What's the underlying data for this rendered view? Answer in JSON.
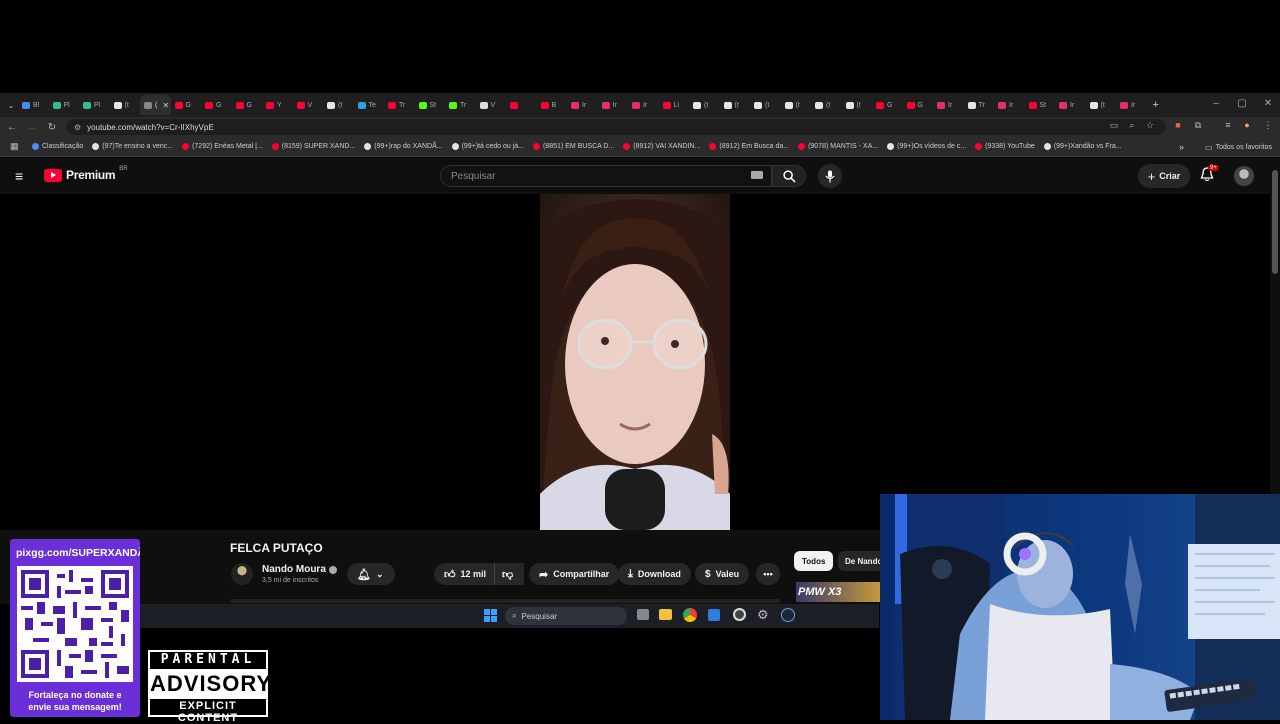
{
  "browser": {
    "tabs": [
      {
        "label": "Bl",
        "color": "#4c8bf5"
      },
      {
        "label": "Pl",
        "color": "#3fb68b"
      },
      {
        "label": "Pl",
        "color": "#3fb68b"
      },
      {
        "label": "(t",
        "color": "#e6e6e6"
      },
      {
        "label": "(",
        "color": "#888888",
        "active": true
      },
      {
        "label": "G",
        "color": "#ff0033"
      },
      {
        "label": "G",
        "color": "#ff0033"
      },
      {
        "label": "G",
        "color": "#ff0033"
      },
      {
        "label": "Y",
        "color": "#ff0033"
      },
      {
        "label": "V",
        "color": "#ff0033"
      },
      {
        "label": "(t",
        "color": "#e6e6e6"
      },
      {
        "label": "Te",
        "color": "#2aa3df"
      },
      {
        "label": "Tr",
        "color": "#ff0033"
      },
      {
        "label": "St",
        "color": "#53fc18"
      },
      {
        "label": "Tr",
        "color": "#53fc18"
      },
      {
        "label": "V",
        "color": "#dddddd"
      },
      {
        "label": "",
        "color": "#ff0033"
      },
      {
        "label": "B",
        "color": "#ff0033"
      },
      {
        "label": "Ir",
        "color": "#e1306c"
      },
      {
        "label": "Ir",
        "color": "#e1306c"
      },
      {
        "label": "Ir",
        "color": "#e1306c"
      },
      {
        "label": "Li",
        "color": "#ff0033"
      },
      {
        "label": "(t",
        "color": "#e6e6e6"
      },
      {
        "label": "(t",
        "color": "#e6e6e6"
      },
      {
        "label": "(t",
        "color": "#e6e6e6"
      },
      {
        "label": "(t",
        "color": "#e6e6e6"
      },
      {
        "label": "(t",
        "color": "#e6e6e6"
      },
      {
        "label": "(t",
        "color": "#e6e6e6"
      },
      {
        "label": "G",
        "color": "#ff0033"
      },
      {
        "label": "G",
        "color": "#ff0033"
      },
      {
        "label": "Ir",
        "color": "#e1306c"
      },
      {
        "label": "Tr",
        "color": "#e6e6e6"
      },
      {
        "label": "Ir",
        "color": "#e1306c"
      },
      {
        "label": "St",
        "color": "#ff0033"
      },
      {
        "label": "Ir",
        "color": "#e1306c"
      },
      {
        "label": "(t",
        "color": "#e6e6e6"
      },
      {
        "label": "Ir",
        "color": "#e1306c"
      }
    ],
    "url": "youtube.com/watch?v=Cr-IIXhyVpE",
    "bookmarks": [
      {
        "label": "Classificação",
        "color": "#4c8bf5"
      },
      {
        "label": "(97)Te ensino a venc...",
        "color": "#e6e6e6"
      },
      {
        "label": "(7292) Enéas Metal |...",
        "color": "#ff0033"
      },
      {
        "label": "(8159) SUPER XAND...",
        "color": "#ff0033"
      },
      {
        "label": "(99+)rap do XANDÃ...",
        "color": "#e6e6e6"
      },
      {
        "label": "(99+)tá cedo ou já...",
        "color": "#e6e6e6"
      },
      {
        "label": "(8851) EM BUSCA D...",
        "color": "#ff0033"
      },
      {
        "label": "(8912) VAI XANDIN...",
        "color": "#ff0033"
      },
      {
        "label": "(8912) Em Busca da...",
        "color": "#ff0033"
      },
      {
        "label": "(9078) MANTIS - XA...",
        "color": "#ff0033"
      },
      {
        "label": "(99+)Os vídeos de c...",
        "color": "#e6e6e6"
      },
      {
        "label": "(9338) YouTube",
        "color": "#ff0033"
      },
      {
        "label": "(99+)Xandão vs Fra...",
        "color": "#e6e6e6"
      }
    ],
    "all_bookmarks": "Todos os favoritos",
    "overflow_icon": "»"
  },
  "youtube": {
    "logo_text": "Premium",
    "region": "BR",
    "search_placeholder": "Pesquisar",
    "create_label": "Criar",
    "notification_badge": "9+",
    "video_title": "FELCA PUTAÇO",
    "channel_name": "Nando Moura",
    "subscribers": "3,5 mi de inscritos",
    "like_count": "12 mil",
    "share_label": "Compartilhar",
    "download_label": "Download",
    "thanks_label": "Valeu",
    "chip_all": "Todos",
    "chip_from": "De Nando",
    "thumb_text": "PMW X3"
  },
  "taskbar": {
    "search_placeholder": "Pesquisar"
  },
  "overlay": {
    "donate_url": "pixgg.com/SUPERXANDÃ",
    "donate_text_1": "Fortaleça no donate e",
    "donate_text_2": "envie sua mensagem!",
    "advisory_line1": "PARENTAL",
    "advisory_line2": "ADVISORY",
    "advisory_line3": "EXPLICIT CONTENT"
  },
  "colors": {
    "yt_red": "#ff0033",
    "qr_purple": "#6a2fd8",
    "page_bg": "#0f0f0f"
  }
}
